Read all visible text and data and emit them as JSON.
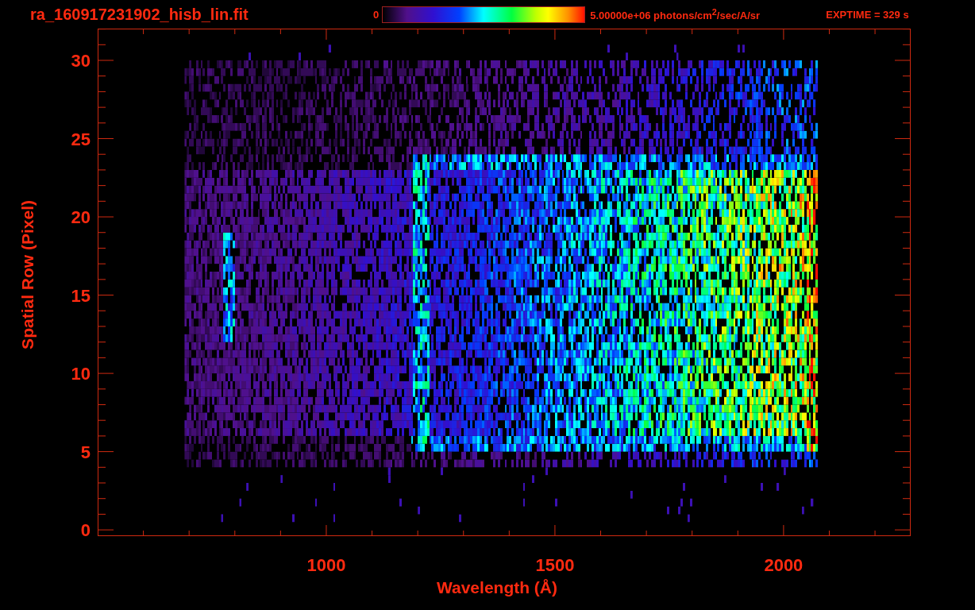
{
  "title": "ra_160917231902_hisb_lin.fit",
  "colorbar": {
    "min_label": "0",
    "max_label": "5.00000e+06 photons/cm$^{2}$/sec/A/sr"
  },
  "exposure": "EXPTIME = 329 s",
  "y_axis": {
    "label": "Spatial Row (Pixel)",
    "ticks": [
      "30",
      "25",
      "20",
      "15",
      "10",
      "5",
      "0"
    ]
  },
  "x_axis": {
    "label": "Wavelength (Å)",
    "ticks": [
      "1000",
      "1500",
      "2000"
    ]
  }
}
